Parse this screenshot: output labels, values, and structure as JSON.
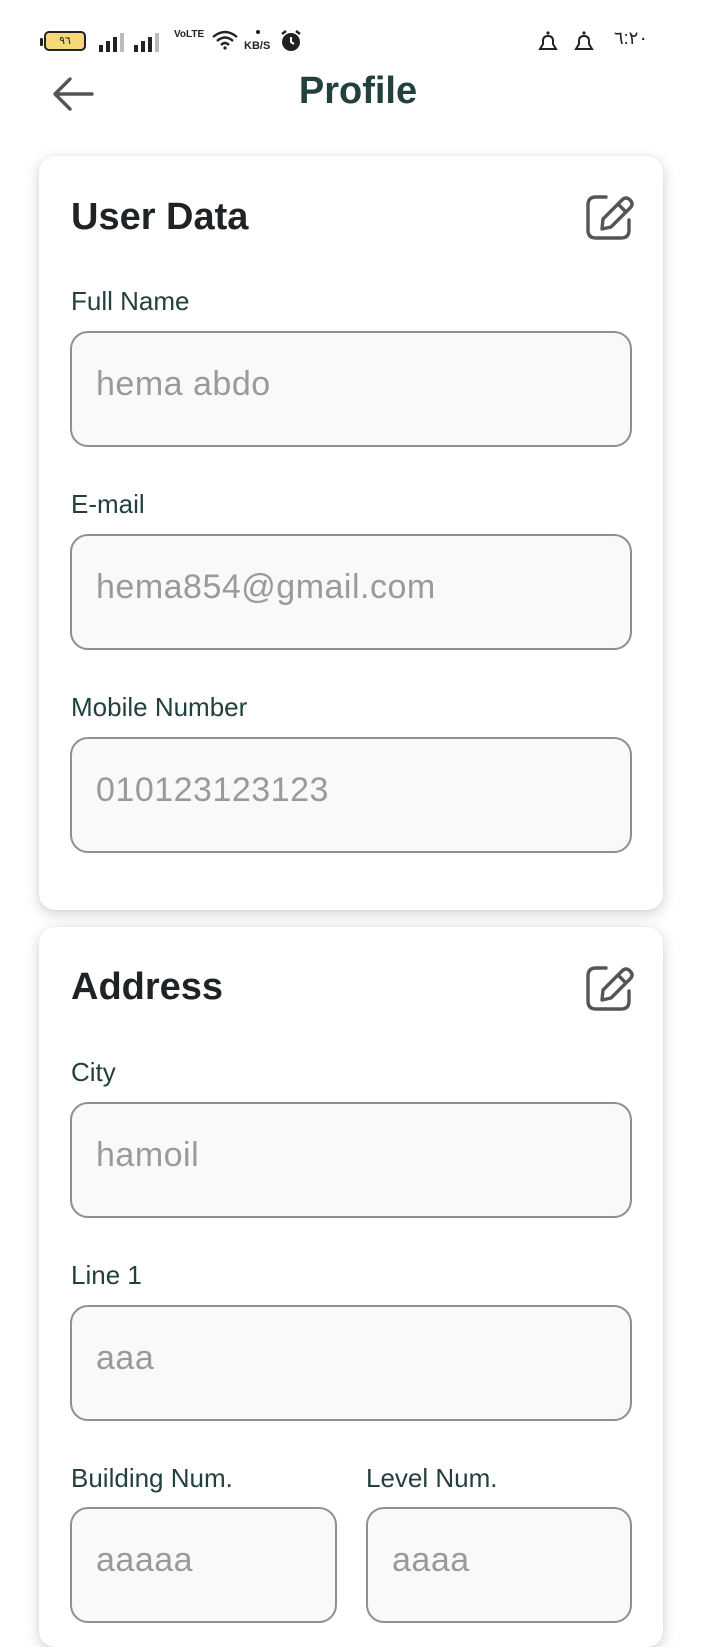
{
  "status_bar": {
    "battery": "٩٦",
    "network": "VoLTE",
    "speed_unit": "KB/S",
    "time": "٦:٢٠"
  },
  "header": {
    "title": "Profile",
    "back_icon": "arrow-left-icon"
  },
  "user_data": {
    "title": "User Data",
    "edit_icon": "edit-icon",
    "fields": [
      {
        "label": "Full Name",
        "value": "hema abdo"
      },
      {
        "label": "E-mail",
        "value": "hema854@gmail.com"
      },
      {
        "label": "Mobile Number",
        "value": "010123123123"
      }
    ]
  },
  "address": {
    "title": "Address",
    "edit_icon": "edit-icon",
    "fields": [
      {
        "label": "City",
        "value": "hamoil"
      },
      {
        "label": "Line 1",
        "value": "aaa"
      },
      {
        "label": "Building Num.",
        "value": "aaaaa"
      },
      {
        "label": "Level Num.",
        "value": "aaaa"
      }
    ]
  },
  "colors": {
    "title": "#22403d",
    "card_title": "#1f2326",
    "field_border": "#8f8f8f",
    "field_bg": "#f9f9f9",
    "field_text": "#9a9a9a"
  }
}
